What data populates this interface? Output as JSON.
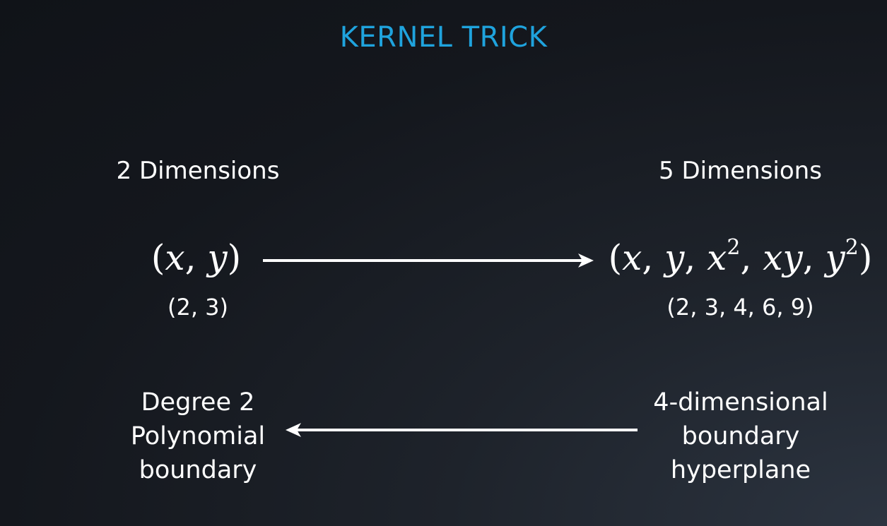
{
  "title": "KERNEL TRICK",
  "left": {
    "heading": "2 Dimensions",
    "vector": [
      "x",
      "y"
    ],
    "example": "(2, 3)"
  },
  "right": {
    "heading": "5 Dimensions",
    "vector": [
      "x",
      "y",
      "x",
      "2",
      "xy",
      "y",
      "2"
    ],
    "example": "(2, 3, 4, 6, 9)"
  },
  "bottom_left": {
    "lines": [
      "Degree 2",
      "Polynomial",
      "boundary"
    ]
  },
  "bottom_right": {
    "lines": [
      "4-dimensional",
      "boundary",
      "hyperplane"
    ]
  },
  "colors": {
    "title": "#1fa3dd",
    "text": "#ffffff",
    "arrow": "#ffffff"
  }
}
